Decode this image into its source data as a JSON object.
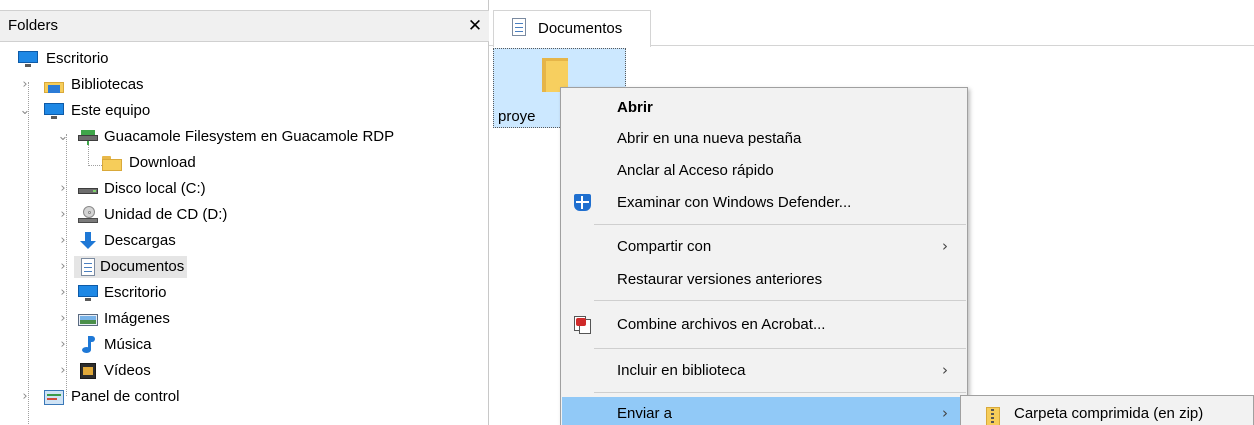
{
  "folders_pane": {
    "title": "Folders",
    "close_glyph": "✕",
    "items": [
      {
        "label": "Escritorio",
        "icon": "desktop-icon"
      },
      {
        "label": "Bibliotecas",
        "icon": "libraries-icon"
      },
      {
        "label": "Este equipo",
        "icon": "this-pc-icon"
      },
      {
        "label": "Guacamole Filesystem en Guacamole RDP",
        "icon": "network-drive-icon"
      },
      {
        "label": "Download",
        "icon": "folder-icon"
      },
      {
        "label": "Disco local (C:)",
        "icon": "local-disk-icon"
      },
      {
        "label": "Unidad de CD (D:)",
        "icon": "cd-drive-icon"
      },
      {
        "label": "Descargas",
        "icon": "downloads-icon"
      },
      {
        "label": "Documentos",
        "icon": "documents-icon",
        "selected": true
      },
      {
        "label": "Escritorio",
        "icon": "desktop-icon"
      },
      {
        "label": "Imágenes",
        "icon": "pictures-icon"
      },
      {
        "label": "Música",
        "icon": "music-icon"
      },
      {
        "label": "Vídeos",
        "icon": "videos-icon"
      },
      {
        "label": "Panel de control",
        "icon": "control-panel-icon"
      }
    ]
  },
  "tab": {
    "label": "Documentos",
    "icon": "documents-icon"
  },
  "file_item": {
    "name": "proye",
    "icon": "folder-icon"
  },
  "context_menu": {
    "items": [
      {
        "label": "Abrir",
        "bold": true
      },
      {
        "label": "Abrir en una nueva pestaña"
      },
      {
        "label": "Anclar al Acceso rápido"
      },
      {
        "label": "Examinar con Windows Defender...",
        "icon": "windows-defender-icon"
      },
      {
        "label": "Compartir con",
        "submenu": true
      },
      {
        "label": "Restaurar versiones anteriores"
      },
      {
        "label": "Combine archivos en Acrobat...",
        "icon": "acrobat-icon"
      },
      {
        "label": "Incluir en biblioteca",
        "submenu": true
      },
      {
        "label": "Enviar a",
        "submenu": true,
        "highlighted": true
      }
    ],
    "submenu_arrow": "›",
    "highlight_color": "#91c9f7"
  },
  "send_to_submenu": {
    "items": [
      {
        "label": "Carpeta comprimida (en zip)",
        "icon": "zip-folder-icon"
      }
    ]
  },
  "colors": {
    "selection_blue": "#cce8ff",
    "menu_background": "#f2f2f2",
    "tree_selected": "#e5e5e5"
  }
}
